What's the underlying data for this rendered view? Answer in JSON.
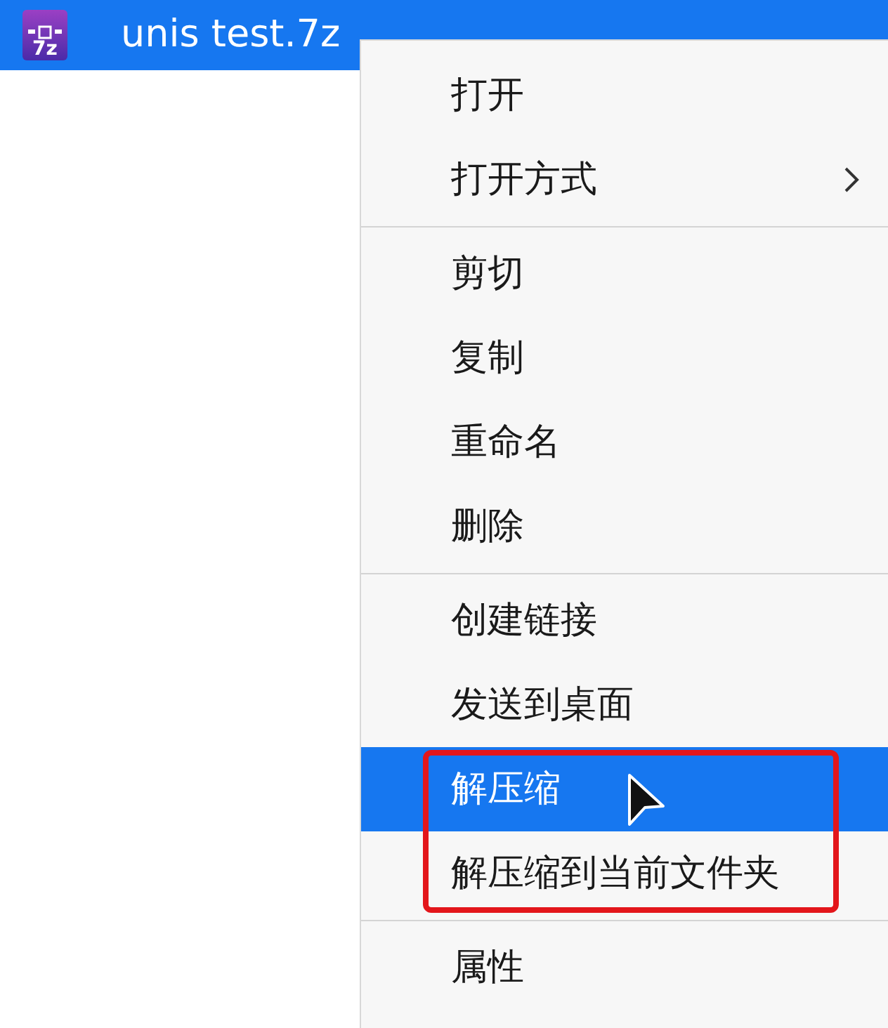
{
  "file": {
    "name": "unis test.7z",
    "selected": true,
    "icon_text": "7z"
  },
  "context_menu": {
    "sections": [
      {
        "items": [
          {
            "label": "打开",
            "selected": false,
            "submenu": false,
            "outlined": false
          },
          {
            "label": "打开方式",
            "selected": false,
            "submenu": true,
            "outlined": false
          }
        ]
      },
      {
        "items": [
          {
            "label": "剪切",
            "selected": false,
            "submenu": false,
            "outlined": false
          },
          {
            "label": "复制",
            "selected": false,
            "submenu": false,
            "outlined": false
          },
          {
            "label": "重命名",
            "selected": false,
            "submenu": false,
            "outlined": false
          },
          {
            "label": "删除",
            "selected": false,
            "submenu": false,
            "outlined": false
          }
        ]
      },
      {
        "items": [
          {
            "label": "创建链接",
            "selected": false,
            "submenu": false,
            "outlined": false
          },
          {
            "label": "发送到桌面",
            "selected": false,
            "submenu": false,
            "outlined": false
          },
          {
            "label": "解压缩",
            "selected": true,
            "submenu": false,
            "outlined": true
          },
          {
            "label": "解压缩到当前文件夹",
            "selected": false,
            "submenu": false,
            "outlined": true
          }
        ]
      },
      {
        "items": [
          {
            "label": "属性",
            "selected": false,
            "submenu": false,
            "outlined": false
          }
        ]
      }
    ]
  }
}
